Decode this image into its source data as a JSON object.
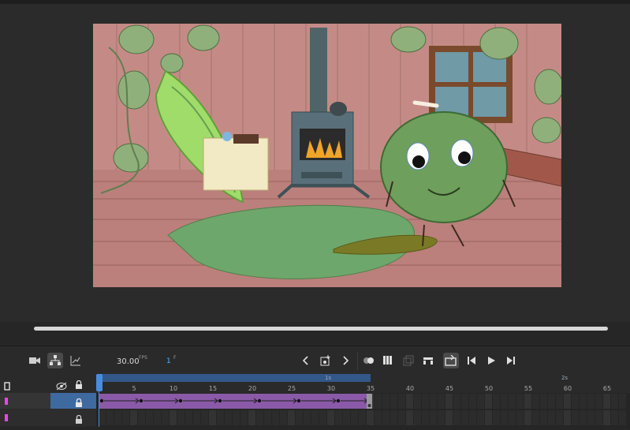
{
  "timeline": {
    "fps_value": "30.00",
    "fps_unit": "FPS",
    "current_frame": "1",
    "frame_unit": "F",
    "second_labels": [
      "1s",
      "2s"
    ],
    "frame_ticks": [
      "5",
      "10",
      "15",
      "20",
      "25",
      "30",
      "35",
      "40",
      "45",
      "50",
      "55",
      "60",
      "65"
    ],
    "tween_end_frame": 35,
    "layers": [
      {
        "color": "#e24ae0",
        "selected": true
      },
      {
        "color": "#e24ae0",
        "selected": false
      }
    ]
  },
  "icons": {
    "camera": "camera-icon",
    "layer_parenting": "layer-parenting-icon",
    "graph": "graph-icon",
    "prev_keyframe": "chevron-left-icon",
    "insert_keyframe": "insert-keyframe-icon",
    "next_keyframe": "chevron-right-icon",
    "onion_skin": "onion-skin-icon",
    "edit_multiple": "edit-multiple-frames-icon",
    "center_frame": "center-frame-icon",
    "loop": "loop-icon",
    "step_back": "step-back-icon",
    "play": "play-icon",
    "step_forward": "step-forward-icon"
  },
  "colors": {
    "accent": "#4a8cdc",
    "tween": "#8a5aa8",
    "layer": "#e24ae0"
  }
}
